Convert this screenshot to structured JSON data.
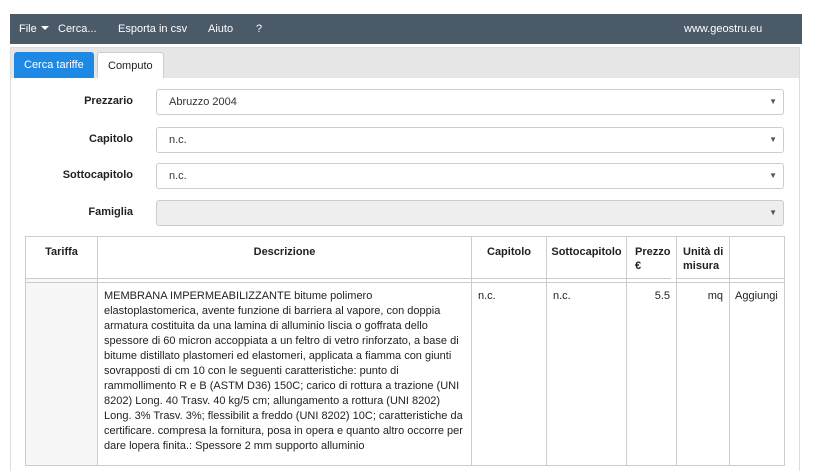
{
  "menu": {
    "file": "File",
    "search": "Cerca...",
    "export": "Esporta in csv",
    "help": "Aiuto",
    "question": "?",
    "site": "www.geostru.eu"
  },
  "tabs": [
    {
      "label": "Cerca tariffe",
      "active": true
    },
    {
      "label": "Computo",
      "active": false
    }
  ],
  "form": {
    "prezzario": {
      "label": "Prezzario",
      "value": "Abruzzo 2004"
    },
    "capitolo": {
      "label": "Capitolo",
      "value": "n.c."
    },
    "sottocapitolo": {
      "label": "Sottocapitolo",
      "value": "n.c."
    },
    "famiglia": {
      "label": "Famiglia",
      "value": ""
    }
  },
  "table": {
    "headers": {
      "tariffa": "Tariffa",
      "descrizione": "Descrizione",
      "capitolo": "Capitolo",
      "sottocapitolo": "Sottocapitolo",
      "prezzo": "Prezzo €",
      "unita": "Unità di misura",
      "azione": ""
    },
    "rows": [
      {
        "tariffa": "",
        "descrizione": "MEMBRANA IMPERMEABILIZZANTE bitume polimero elastoplastomerica, avente funzione di barriera al vapore, con doppia armatura costituita da una lamina di alluminio liscia o goffrata dello spessore di 60 micron accoppiata a un feltro di vetro rinforzato, a base di bitume distillato plastomeri ed elastomeri, applicata a fiamma con giunti sovrapposti di cm 10 con le seguenti caratteristiche: punto di rammollimento R e B (ASTM D36) 150C; carico di rottura a trazione (UNI 8202) Long. 40 Trasv. 40 kg/5 cm; allungamento a rottura (UNI 8202) Long. 3% Trasv. 3%; flessibilit a freddo (UNI 8202) 10C; caratteristiche da certificare. compresa la fornitura, posa in opera e quanto altro occorre per dare lopera finita.: Spessore 2 mm supporto alluminio",
        "capitolo": "n.c.",
        "sottocapitolo": "n.c.",
        "prezzo": "5.5",
        "unita": "mq",
        "azione": "Aggiungi"
      }
    ]
  },
  "colors": {
    "topbar": "#4a5a68",
    "active_tab": "#1e88e5"
  }
}
